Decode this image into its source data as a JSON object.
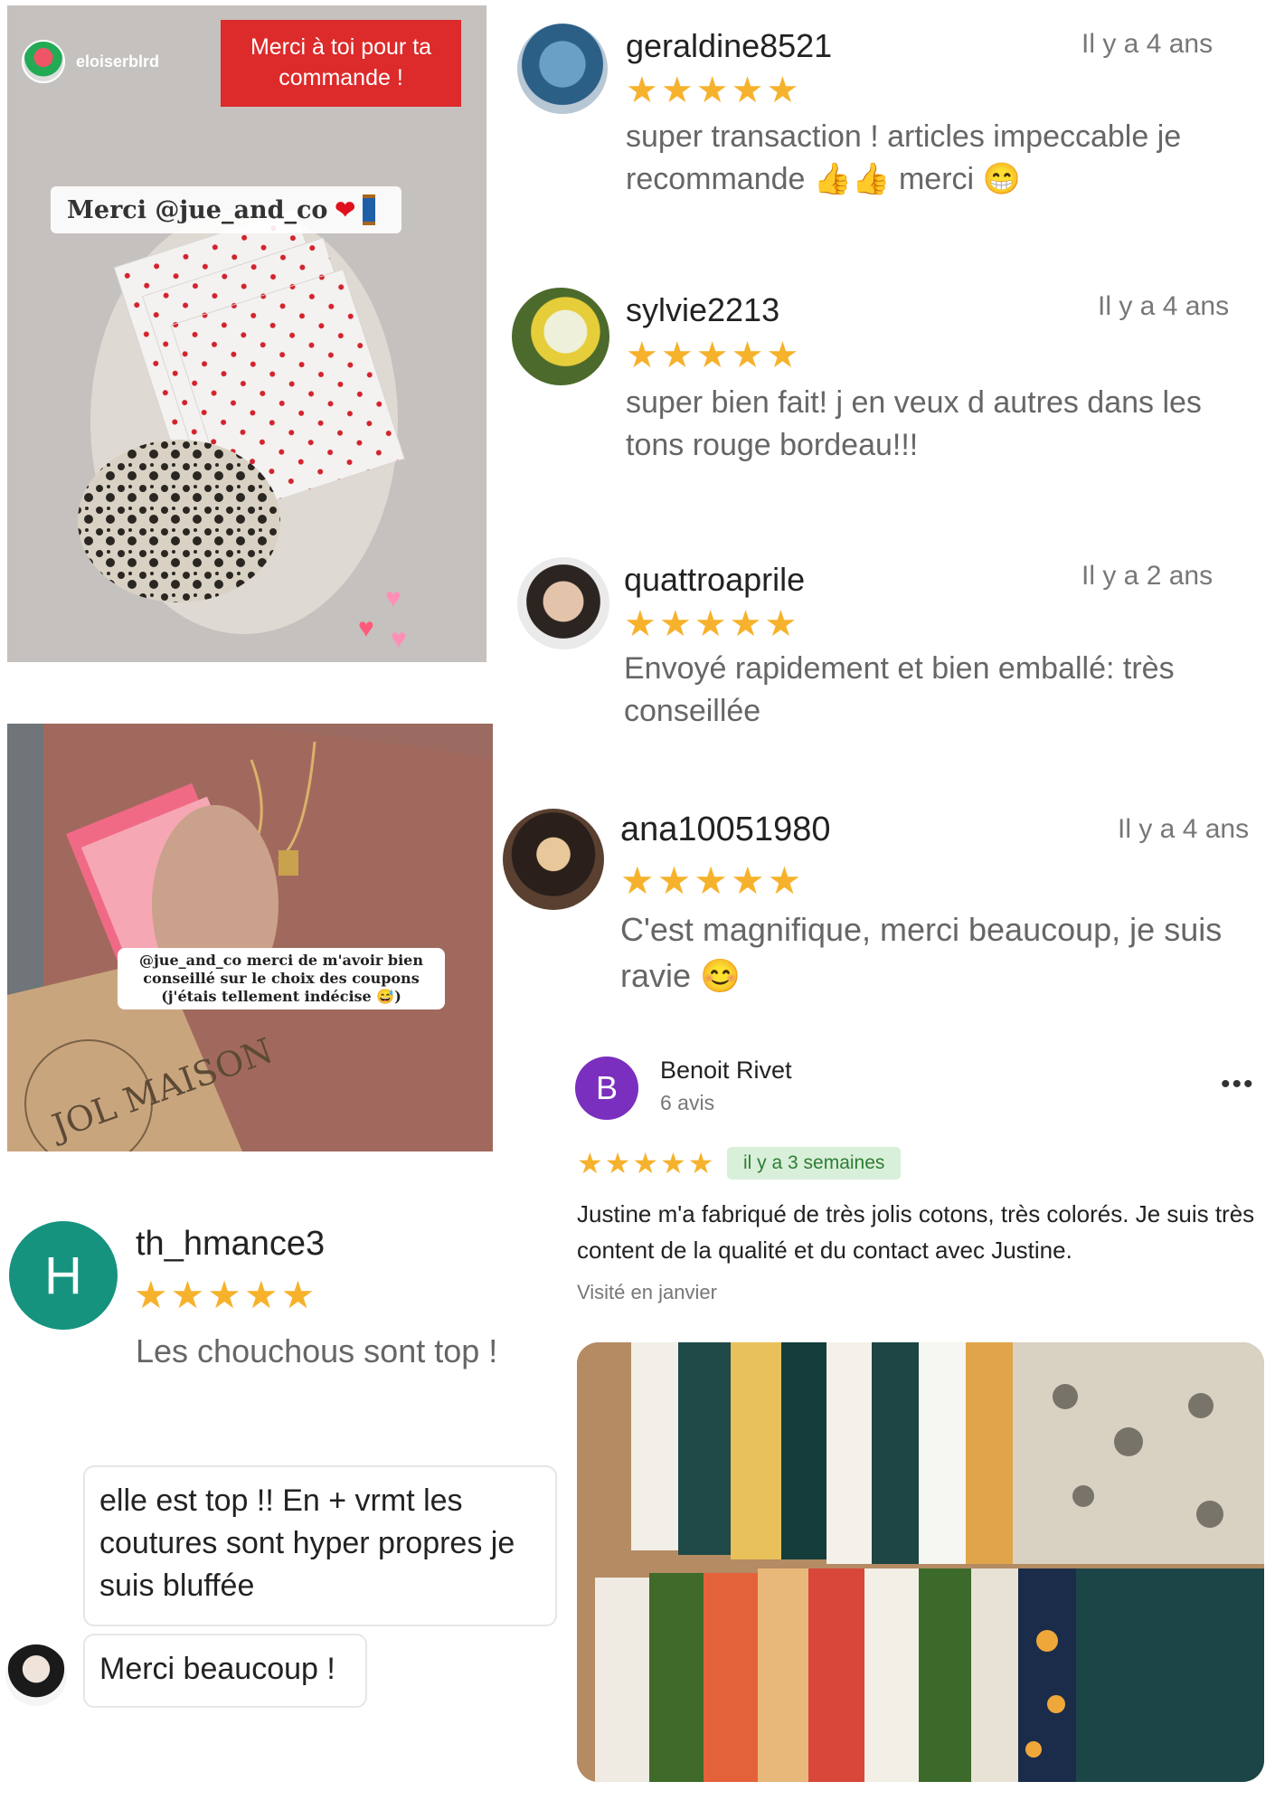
{
  "story1": {
    "username": "eloiserblrd",
    "badge": "Merci à toi pour ta commande !",
    "sticker": "Merci @jue_and_co"
  },
  "story2": {
    "caption": "@jue_and_co merci de m'avoir bien conseillé sur le choix des coupons (j'étais tellement indécise 😅)",
    "bag_text": "JOL MAISON"
  },
  "reviews": [
    {
      "user": "geraldine8521",
      "time": "Il y a 4 ans",
      "stars": "★★★★★",
      "text": "super transaction ! articles impeccable je recommande 👍👍 merci 😁"
    },
    {
      "user": "sylvie2213",
      "time": "Il y a 4 ans",
      "stars": "★★★★★",
      "text": "super bien fait! j en veux d autres dans les tons rouge bordeau!!!"
    },
    {
      "user": "quattroaprile",
      "time": "Il y a 2 ans",
      "stars": "★★★★★",
      "text": "Envoyé rapidement et bien emballé: très conseillée"
    },
    {
      "user": "ana10051980",
      "time": "Il y a 4 ans",
      "stars": "★★★★★",
      "text": "C'est magnifique, merci beaucoup, je suis ravie 😊"
    }
  ],
  "google_review": {
    "initial": "B",
    "avatar_color": "#7b2fbe",
    "name": "Benoit Rivet",
    "count": "6 avis",
    "stars": "★★★★★",
    "time": "il y a 3 semaines",
    "text": "Justine m'a fabriqué de très jolis cotons, très colorés. Je suis très content de la qualité et du contact avec Justine.",
    "visit": "Visité en janvier",
    "menu": "•••"
  },
  "th_review": {
    "initial": "H",
    "avatar_color": "#16937f",
    "user": "th_hmance3",
    "stars": "★★★★★",
    "text": "Les chouchous sont top !"
  },
  "chat": {
    "message1": "elle est top !! En + vrmt les coutures sont hyper propres je suis bluffée",
    "message2": "Merci beaucoup !"
  },
  "colors": {
    "star": "#f6b22c",
    "badge": "#dd2a2a",
    "chip_bg": "#d8efd9",
    "chip_text": "#2e7d32"
  }
}
